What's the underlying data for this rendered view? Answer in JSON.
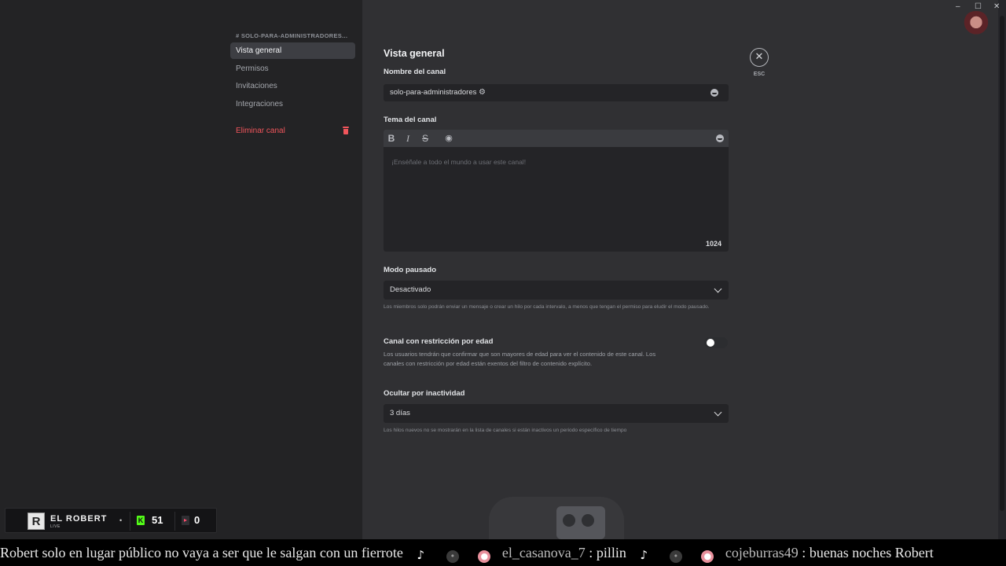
{
  "sidebar": {
    "header": "# SOLO-PARA-ADMINISTRADORES...",
    "items": [
      {
        "label": "Vista general"
      },
      {
        "label": "Permisos"
      },
      {
        "label": "Invitaciones"
      },
      {
        "label": "Integraciones"
      }
    ],
    "delete_label": "Eliminar canal"
  },
  "main": {
    "title": "Vista general",
    "channel_name_label": "Nombre del canal",
    "channel_name_value": "solo-para-administradores",
    "topic_label": "Tema del canal",
    "topic_placeholder": "¡Enséñale a todo el mundo a usar este canal!",
    "topic_counter": "1024",
    "slowmode_label": "Modo pausado",
    "slowmode_value": "Desactivado",
    "slowmode_help": "Los miembros solo podrán enviar un mensaje o crear un hilo por cada intervalo, a menos que tengan el permiso para eludir el modo pausado.",
    "nsfw_label": "Canal con restricción por edad",
    "nsfw_help": "Los usuarios tendrán que confirmar que son mayores de edad para ver el contenido de este canal. Los canales con restricción por edad están exentos del filtro de contenido explícito.",
    "nsfw_enabled": false,
    "archive_label": "Ocultar por inactividad",
    "archive_value": "3 días",
    "archive_help": "Los hilos nuevos no se mostrarán en la lista de canales si están inactivos un periodo específico de tiempo"
  },
  "close": {
    "icon": "close-icon",
    "label": "ESC"
  },
  "window_controls": [
    "–",
    "☐",
    "✕"
  ],
  "stream_overlay": {
    "name": "EL ROBERT",
    "live": "LIVE",
    "kick_count": "51",
    "other_count": "0",
    "kick_color": "#53fc18"
  },
  "ticker": {
    "message1": "Robert solo en lugar público no vaya a ser que le salgan con un fierrote",
    "user2": "el_casanova_7",
    "message2": "pillin",
    "user3": "cojeburras49",
    "message3": "buenas noches Robert",
    "separator": ":"
  },
  "colors": {
    "accent_danger": "#f0555b",
    "active_bg": "#3d3e43"
  }
}
